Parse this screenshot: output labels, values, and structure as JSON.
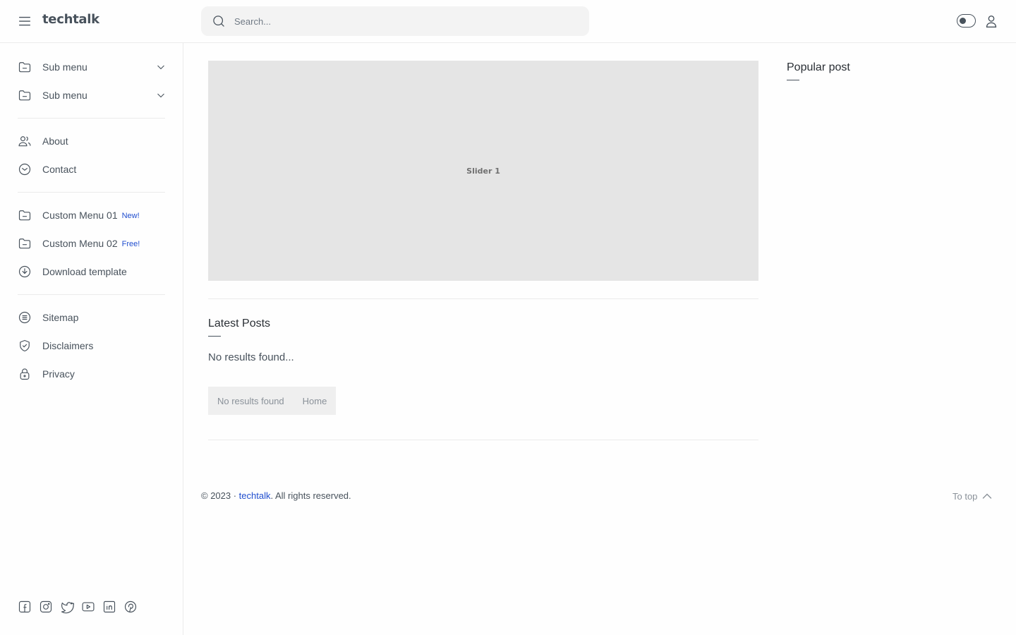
{
  "header": {
    "logo": "techtalk",
    "search_placeholder": "Search...",
    "icons": [
      "hamburger-menu-icon",
      "search-icon",
      "dark-mode-toggle-icon",
      "user-icon"
    ]
  },
  "sidebar": {
    "groups": [
      [
        {
          "label": "Sub menu",
          "icon": "folder-icon",
          "dropdown": true
        },
        {
          "label": "Sub menu",
          "icon": "folder-icon",
          "dropdown": true
        }
      ],
      [
        {
          "label": "About",
          "icon": "users-icon"
        },
        {
          "label": "Contact",
          "icon": "mail-icon"
        }
      ],
      [
        {
          "label": "Custom Menu 01",
          "icon": "folder-icon",
          "badge": "New!"
        },
        {
          "label": "Custom Menu 02",
          "icon": "folder-icon",
          "badge": "Free!"
        },
        {
          "label": "Download template",
          "icon": "download-icon"
        }
      ],
      [
        {
          "label": "Sitemap",
          "icon": "list-icon"
        },
        {
          "label": "Disclaimers",
          "icon": "shield-icon"
        },
        {
          "label": "Privacy",
          "icon": "lock-icon"
        }
      ]
    ],
    "socials": [
      "facebook-icon",
      "instagram-icon",
      "twitter-icon",
      "youtube-icon",
      "linkedin-icon",
      "pinterest-icon"
    ]
  },
  "main": {
    "slider_label": "Slider 1",
    "latest_title": "Latest Posts",
    "no_results": "No results found...",
    "breadcrumbs": [
      "No results found",
      "Home"
    ]
  },
  "aside": {
    "popular_title": "Popular post"
  },
  "footer": {
    "copy_prefix": "© 2023 · ",
    "brand": "techtalk",
    "copy_suffix": ". All rights reserved.",
    "to_top": "To top"
  },
  "colors": {
    "accent": "#204ecf",
    "text": "#48525c",
    "slider_bg": "#e5e5e5"
  }
}
